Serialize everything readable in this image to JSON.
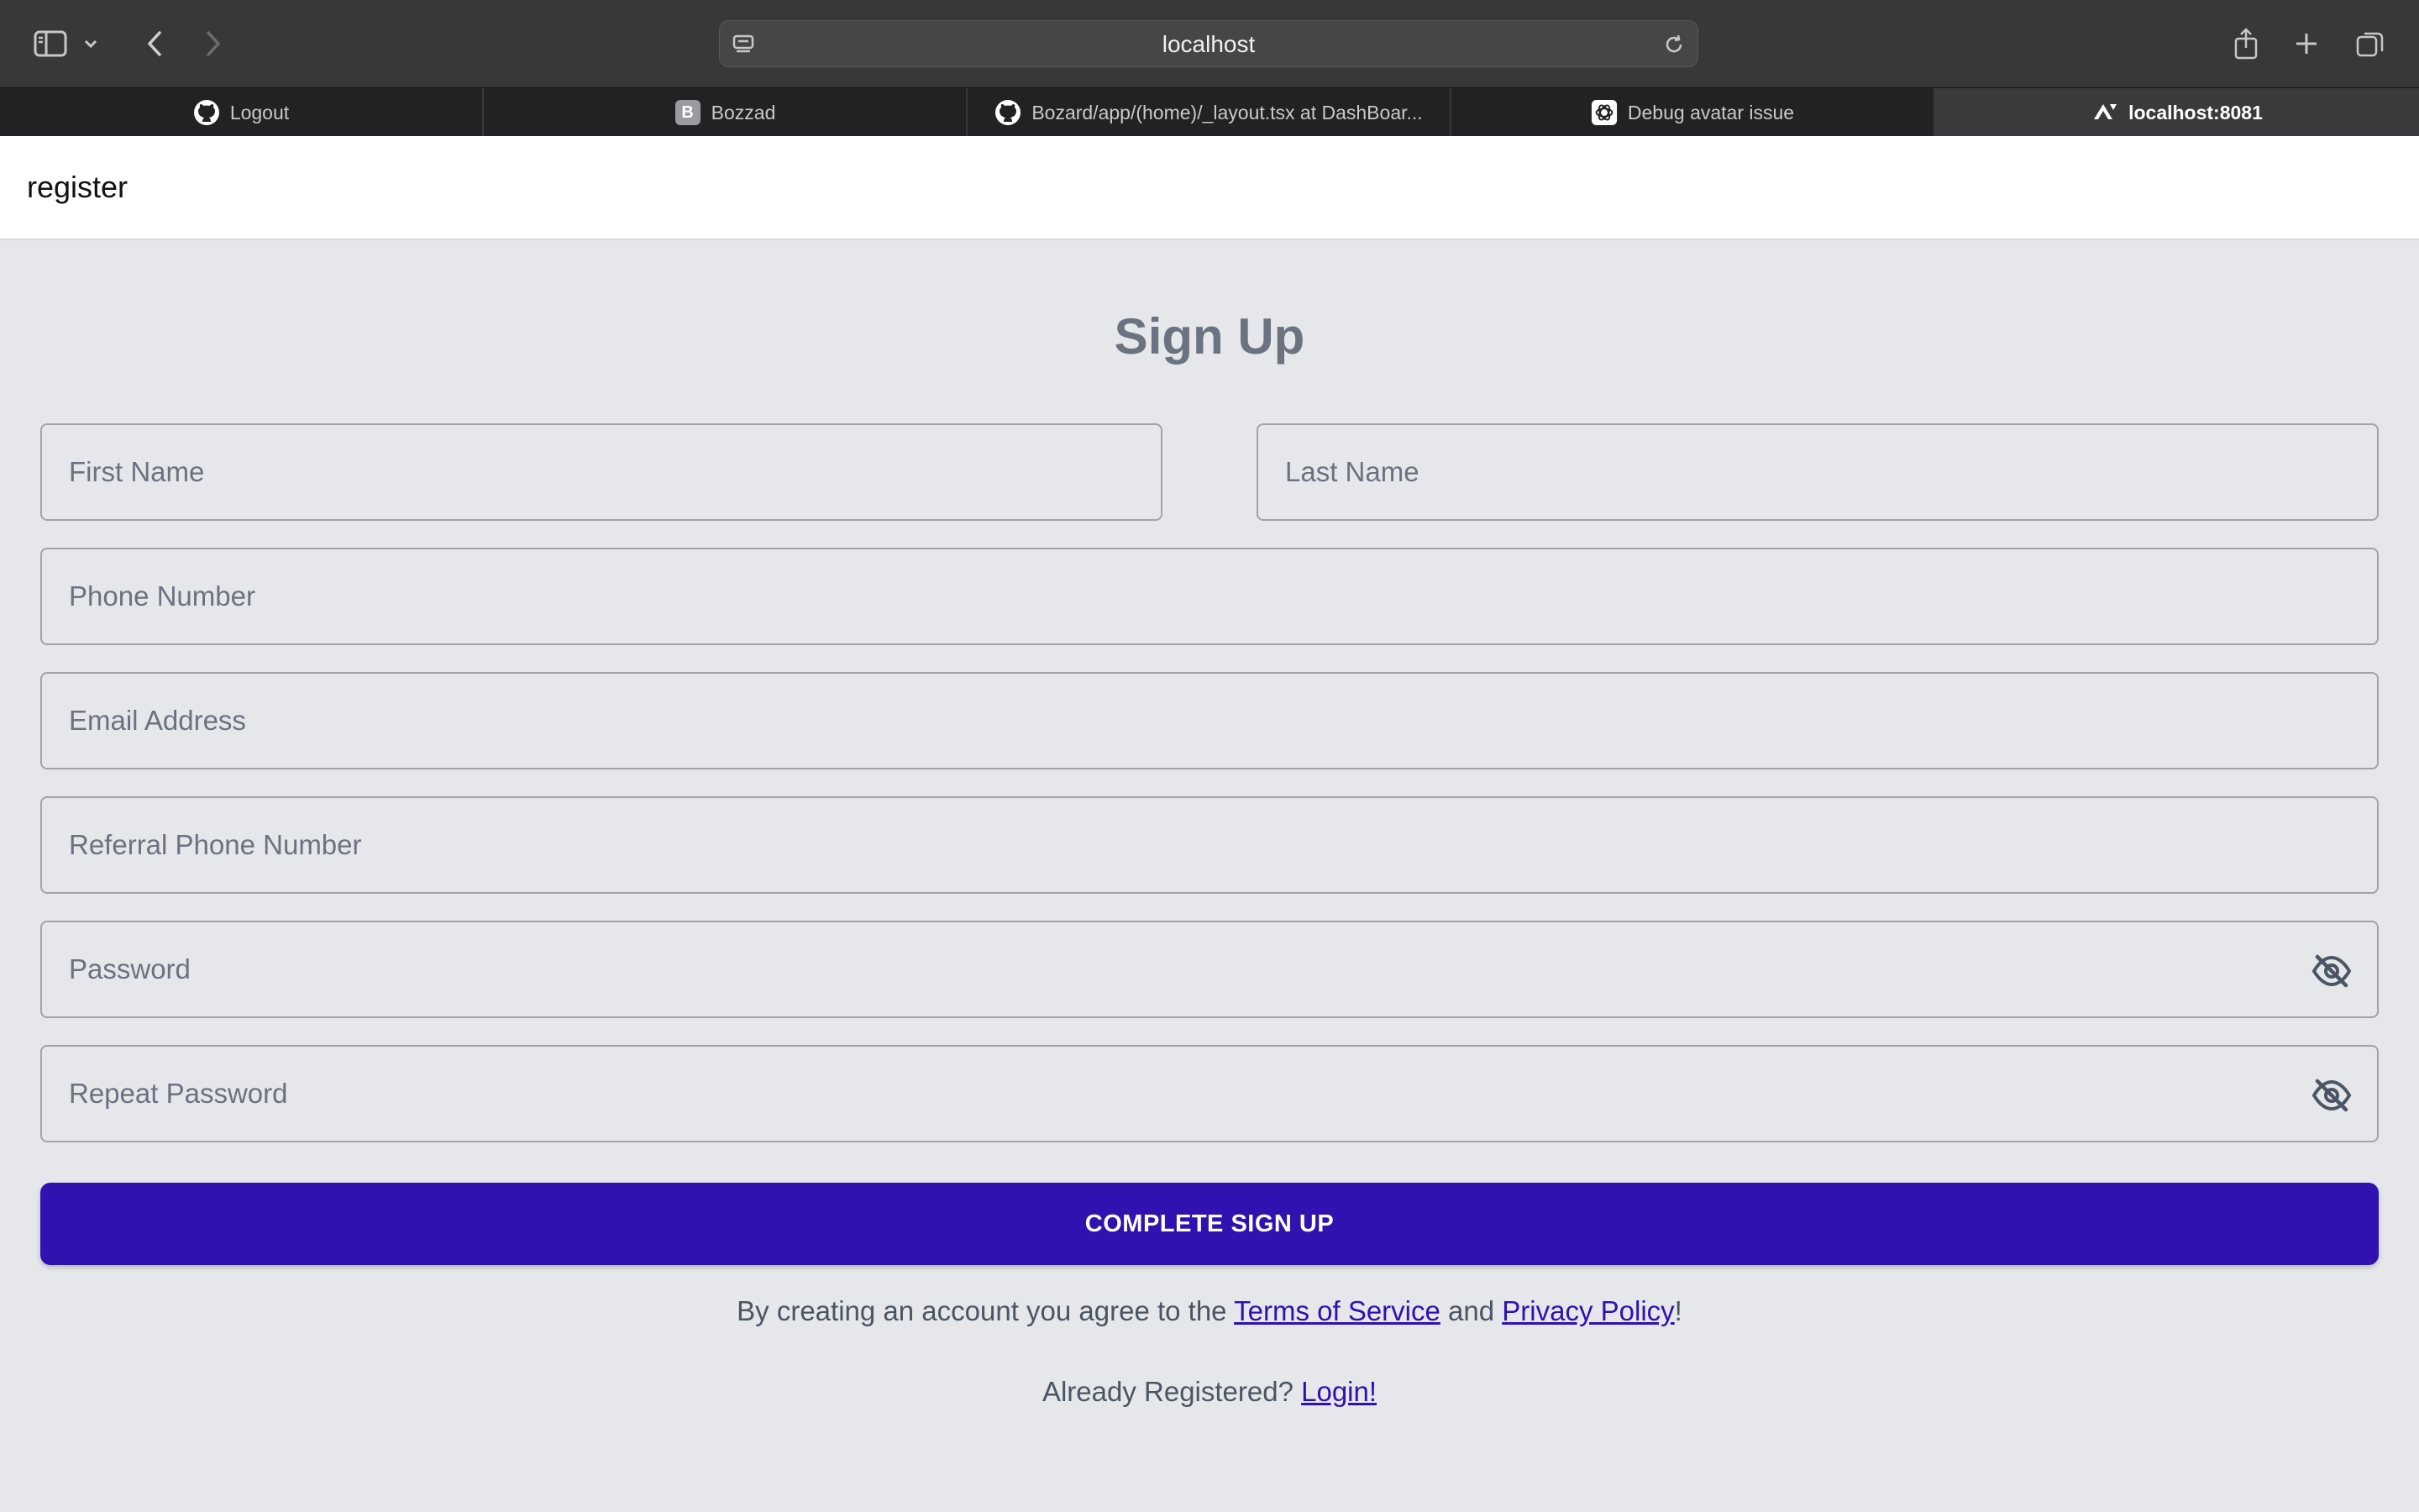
{
  "browser": {
    "url": "localhost",
    "tabs": [
      {
        "label": "Logout",
        "icon": "github-icon"
      },
      {
        "label": "Bozzad",
        "icon": "b-favicon-icon",
        "favicon_letter": "B"
      },
      {
        "label": "Bozard/app/(home)/_layout.tsx at DashBoar...",
        "icon": "github-icon"
      },
      {
        "label": "Debug avatar issue",
        "icon": "openai-icon"
      },
      {
        "label": "localhost:8081",
        "icon": "expo-icon",
        "active": true
      }
    ]
  },
  "page": {
    "header_title": "register",
    "title": "Sign Up",
    "fields": {
      "first_name": "First Name",
      "last_name": "Last Name",
      "phone": "Phone Number",
      "email": "Email Address",
      "referral": "Referral Phone Number",
      "password": "Password",
      "repeat_password": "Repeat Password"
    },
    "submit_label": "COMPLETE SIGN UP",
    "legal": {
      "prefix": "By creating an account you agree to the ",
      "terms": "Terms of Service",
      "middle": " and ",
      "privacy": "Privacy Policy",
      "suffix": "!"
    },
    "already": {
      "prefix": "Already Registered? ",
      "login": "Login!"
    }
  },
  "colors": {
    "primary": "#2f12b0",
    "background": "#e5e7eb",
    "toolbar": "#38383a"
  }
}
